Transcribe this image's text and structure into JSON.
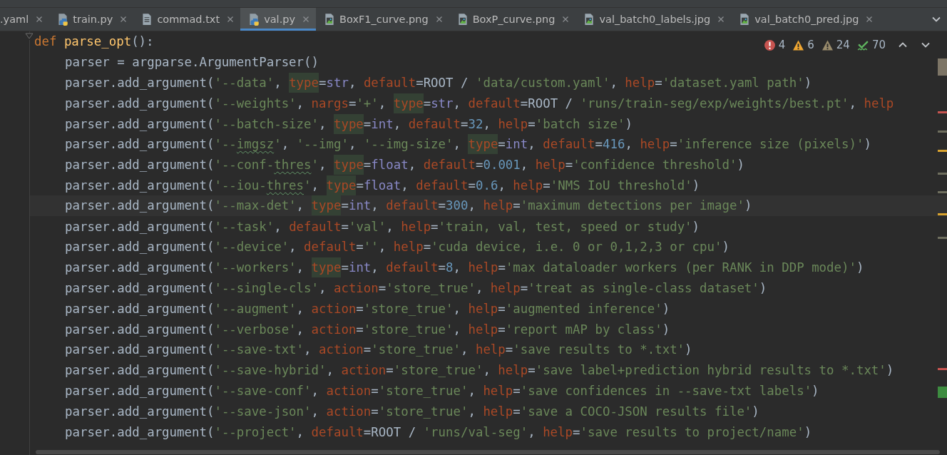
{
  "tabs": [
    {
      "label": ".yaml",
      "kind": "yaml",
      "selected": false
    },
    {
      "label": "train.py",
      "kind": "python",
      "selected": false
    },
    {
      "label": "commad.txt",
      "kind": "text",
      "selected": false
    },
    {
      "label": "val.py",
      "kind": "python",
      "selected": true
    },
    {
      "label": "BoxF1_curve.png",
      "kind": "image",
      "selected": false
    },
    {
      "label": "BoxP_curve.png",
      "kind": "image",
      "selected": false
    },
    {
      "label": "val_batch0_labels.jpg",
      "kind": "image",
      "selected": false
    },
    {
      "label": "val_batch0_pred.jpg",
      "kind": "image",
      "selected": false
    }
  ],
  "inspections": [
    {
      "kind": "error",
      "count": "4"
    },
    {
      "kind": "warning",
      "count": "6"
    },
    {
      "kind": "weak",
      "count": "24"
    },
    {
      "kind": "typo",
      "count": "70"
    }
  ],
  "code": [
    {
      "current": false,
      "tokens": [
        {
          "kind": "keyword",
          "text": "def "
        },
        {
          "kind": "function",
          "text": "parse_opt"
        },
        {
          "kind": "plain",
          "text": "():"
        }
      ],
      "children": [
        {
          "current": false,
          "tokens": [
            {
              "kind": "plain",
              "text": "parser = argparse.ArgumentParser()"
            }
          ]
        },
        {
          "current": false,
          "tokens": [
            {
              "kind": "plain",
              "text": "parser.add_argument("
            },
            {
              "kind": "string",
              "text": "'--data'"
            },
            {
              "kind": "plain",
              "text": ", "
            },
            {
              "kind": "kwarg",
              "text": "type",
              "highlight": true
            },
            {
              "kind": "plain",
              "text": "="
            },
            {
              "kind": "builtin",
              "text": "str"
            },
            {
              "kind": "plain",
              "text": ", "
            },
            {
              "kind": "kwarg",
              "text": "default"
            },
            {
              "kind": "plain",
              "text": "=ROOT / "
            },
            {
              "kind": "string",
              "text": "'data/custom.yaml'"
            },
            {
              "kind": "plain",
              "text": ", "
            },
            {
              "kind": "kwarg",
              "text": "help"
            },
            {
              "kind": "plain",
              "text": "="
            },
            {
              "kind": "string",
              "text": "'dataset.yaml path'"
            },
            {
              "kind": "plain",
              "text": ")"
            }
          ]
        },
        {
          "current": false,
          "tokens": [
            {
              "kind": "plain",
              "text": "parser.add_argument("
            },
            {
              "kind": "string",
              "text": "'--weights'"
            },
            {
              "kind": "plain",
              "text": ", "
            },
            {
              "kind": "kwarg",
              "text": "nargs"
            },
            {
              "kind": "plain",
              "text": "="
            },
            {
              "kind": "string",
              "text": "'+'"
            },
            {
              "kind": "plain",
              "text": ", "
            },
            {
              "kind": "kwarg",
              "text": "type",
              "highlight": true
            },
            {
              "kind": "plain",
              "text": "="
            },
            {
              "kind": "builtin",
              "text": "str"
            },
            {
              "kind": "plain",
              "text": ", "
            },
            {
              "kind": "kwarg",
              "text": "default"
            },
            {
              "kind": "plain",
              "text": "=ROOT / "
            },
            {
              "kind": "string",
              "text": "'runs/train-seg/exp/weights/best.pt'"
            },
            {
              "kind": "plain",
              "text": ", "
            },
            {
              "kind": "kwarg",
              "text": "help"
            }
          ]
        },
        {
          "current": false,
          "tokens": [
            {
              "kind": "plain",
              "text": "parser.add_argument("
            },
            {
              "kind": "string",
              "text": "'--batch-size'"
            },
            {
              "kind": "plain",
              "text": ", "
            },
            {
              "kind": "kwarg",
              "text": "type",
              "highlight": true
            },
            {
              "kind": "plain",
              "text": "="
            },
            {
              "kind": "builtin",
              "text": "int"
            },
            {
              "kind": "plain",
              "text": ", "
            },
            {
              "kind": "kwarg",
              "text": "default"
            },
            {
              "kind": "plain",
              "text": "="
            },
            {
              "kind": "number",
              "text": "32"
            },
            {
              "kind": "plain",
              "text": ", "
            },
            {
              "kind": "kwarg",
              "text": "help"
            },
            {
              "kind": "plain",
              "text": "="
            },
            {
              "kind": "string",
              "text": "'batch size'"
            },
            {
              "kind": "plain",
              "text": ")"
            }
          ]
        },
        {
          "current": false,
          "tokens": [
            {
              "kind": "plain",
              "text": "parser.add_argument("
            },
            {
              "kind": "string",
              "text": "'--"
            },
            {
              "kind": "string",
              "text": "imgsz",
              "typo": true
            },
            {
              "kind": "string",
              "text": "'"
            },
            {
              "kind": "plain",
              "text": ", "
            },
            {
              "kind": "string",
              "text": "'--img'"
            },
            {
              "kind": "plain",
              "text": ", "
            },
            {
              "kind": "string",
              "text": "'--img-size'"
            },
            {
              "kind": "plain",
              "text": ", "
            },
            {
              "kind": "kwarg",
              "text": "type",
              "highlight": true
            },
            {
              "kind": "plain",
              "text": "="
            },
            {
              "kind": "builtin",
              "text": "int"
            },
            {
              "kind": "plain",
              "text": ", "
            },
            {
              "kind": "kwarg",
              "text": "default"
            },
            {
              "kind": "plain",
              "text": "="
            },
            {
              "kind": "number",
              "text": "416"
            },
            {
              "kind": "plain",
              "text": ", "
            },
            {
              "kind": "kwarg",
              "text": "help"
            },
            {
              "kind": "plain",
              "text": "="
            },
            {
              "kind": "string",
              "text": "'inference size (pixels)'"
            },
            {
              "kind": "plain",
              "text": ")"
            }
          ]
        },
        {
          "current": false,
          "tokens": [
            {
              "kind": "plain",
              "text": "parser.add_argument("
            },
            {
              "kind": "string",
              "text": "'--conf-"
            },
            {
              "kind": "string",
              "text": "thres",
              "typo": true
            },
            {
              "kind": "string",
              "text": "'"
            },
            {
              "kind": "plain",
              "text": ", "
            },
            {
              "kind": "kwarg",
              "text": "type",
              "highlight": true
            },
            {
              "kind": "plain",
              "text": "="
            },
            {
              "kind": "builtin",
              "text": "float"
            },
            {
              "kind": "plain",
              "text": ", "
            },
            {
              "kind": "kwarg",
              "text": "default"
            },
            {
              "kind": "plain",
              "text": "="
            },
            {
              "kind": "number",
              "text": "0.001"
            },
            {
              "kind": "plain",
              "text": ", "
            },
            {
              "kind": "kwarg",
              "text": "help"
            },
            {
              "kind": "plain",
              "text": "="
            },
            {
              "kind": "string",
              "text": "'confidence threshold'"
            },
            {
              "kind": "plain",
              "text": ")"
            }
          ]
        },
        {
          "current": false,
          "tokens": [
            {
              "kind": "plain",
              "text": "parser.add_argument("
            },
            {
              "kind": "string",
              "text": "'--iou-"
            },
            {
              "kind": "string",
              "text": "thres",
              "typo": true
            },
            {
              "kind": "string",
              "text": "'"
            },
            {
              "kind": "plain",
              "text": ", "
            },
            {
              "kind": "kwarg",
              "text": "type",
              "highlight": true
            },
            {
              "kind": "plain",
              "text": "="
            },
            {
              "kind": "builtin",
              "text": "float"
            },
            {
              "kind": "plain",
              "text": ", "
            },
            {
              "kind": "kwarg",
              "text": "default"
            },
            {
              "kind": "plain",
              "text": "="
            },
            {
              "kind": "number",
              "text": "0.6"
            },
            {
              "kind": "plain",
              "text": ", "
            },
            {
              "kind": "kwarg",
              "text": "help"
            },
            {
              "kind": "plain",
              "text": "="
            },
            {
              "kind": "string",
              "text": "'NMS IoU threshold'"
            },
            {
              "kind": "plain",
              "text": ")"
            }
          ]
        },
        {
          "current": true,
          "tokens": [
            {
              "kind": "plain",
              "text": "parser.add_argument("
            },
            {
              "kind": "string",
              "text": "'--max-det'"
            },
            {
              "kind": "plain",
              "text": ", "
            },
            {
              "kind": "kwarg",
              "text": "t",
              "highlight": true
            },
            {
              "kind": "kwarg",
              "text": "ype",
              "highlight": true,
              "caret": true
            },
            {
              "kind": "plain",
              "text": "="
            },
            {
              "kind": "builtin",
              "text": "int"
            },
            {
              "kind": "plain",
              "text": ", "
            },
            {
              "kind": "kwarg",
              "text": "default"
            },
            {
              "kind": "plain",
              "text": "="
            },
            {
              "kind": "number",
              "text": "300"
            },
            {
              "kind": "plain",
              "text": ", "
            },
            {
              "kind": "kwarg",
              "text": "help"
            },
            {
              "kind": "plain",
              "text": "="
            },
            {
              "kind": "string",
              "text": "'maximum detections per image'"
            },
            {
              "kind": "plain",
              "text": ")"
            }
          ]
        },
        {
          "current": false,
          "tokens": [
            {
              "kind": "plain",
              "text": "parser.add_argument("
            },
            {
              "kind": "string",
              "text": "'--task'"
            },
            {
              "kind": "plain",
              "text": ", "
            },
            {
              "kind": "kwarg",
              "text": "default"
            },
            {
              "kind": "plain",
              "text": "="
            },
            {
              "kind": "string",
              "text": "'val'"
            },
            {
              "kind": "plain",
              "text": ", "
            },
            {
              "kind": "kwarg",
              "text": "help"
            },
            {
              "kind": "plain",
              "text": "="
            },
            {
              "kind": "string",
              "text": "'train, val, test, speed or study'"
            },
            {
              "kind": "plain",
              "text": ")"
            }
          ]
        },
        {
          "current": false,
          "tokens": [
            {
              "kind": "plain",
              "text": "parser.add_argument("
            },
            {
              "kind": "string",
              "text": "'--device'"
            },
            {
              "kind": "plain",
              "text": ", "
            },
            {
              "kind": "kwarg",
              "text": "default"
            },
            {
              "kind": "plain",
              "text": "="
            },
            {
              "kind": "string",
              "text": "''"
            },
            {
              "kind": "plain",
              "text": ", "
            },
            {
              "kind": "kwarg",
              "text": "help"
            },
            {
              "kind": "plain",
              "text": "="
            },
            {
              "kind": "string",
              "text": "'cuda device, i.e. 0 or 0,1,2,3 or cpu'"
            },
            {
              "kind": "plain",
              "text": ")"
            }
          ]
        },
        {
          "current": false,
          "tokens": [
            {
              "kind": "plain",
              "text": "parser.add_argument("
            },
            {
              "kind": "string",
              "text": "'--workers'"
            },
            {
              "kind": "plain",
              "text": ", "
            },
            {
              "kind": "kwarg",
              "text": "type",
              "highlight": true
            },
            {
              "kind": "plain",
              "text": "="
            },
            {
              "kind": "builtin",
              "text": "int"
            },
            {
              "kind": "plain",
              "text": ", "
            },
            {
              "kind": "kwarg",
              "text": "default"
            },
            {
              "kind": "plain",
              "text": "="
            },
            {
              "kind": "number",
              "text": "8"
            },
            {
              "kind": "plain",
              "text": ", "
            },
            {
              "kind": "kwarg",
              "text": "help"
            },
            {
              "kind": "plain",
              "text": "="
            },
            {
              "kind": "string",
              "text": "'max dataloader workers (per RANK in DDP mode)'"
            },
            {
              "kind": "plain",
              "text": ")"
            }
          ]
        },
        {
          "current": false,
          "tokens": [
            {
              "kind": "plain",
              "text": "parser.add_argument("
            },
            {
              "kind": "string",
              "text": "'--single-cls'"
            },
            {
              "kind": "plain",
              "text": ", "
            },
            {
              "kind": "kwarg",
              "text": "action"
            },
            {
              "kind": "plain",
              "text": "="
            },
            {
              "kind": "string",
              "text": "'store_true'"
            },
            {
              "kind": "plain",
              "text": ", "
            },
            {
              "kind": "kwarg",
              "text": "help"
            },
            {
              "kind": "plain",
              "text": "="
            },
            {
              "kind": "string",
              "text": "'treat as single-class dataset'"
            },
            {
              "kind": "plain",
              "text": ")"
            }
          ]
        },
        {
          "current": false,
          "tokens": [
            {
              "kind": "plain",
              "text": "parser.add_argument("
            },
            {
              "kind": "string",
              "text": "'--augment'"
            },
            {
              "kind": "plain",
              "text": ", "
            },
            {
              "kind": "kwarg",
              "text": "action"
            },
            {
              "kind": "plain",
              "text": "="
            },
            {
              "kind": "string",
              "text": "'store_true'"
            },
            {
              "kind": "plain",
              "text": ", "
            },
            {
              "kind": "kwarg",
              "text": "help"
            },
            {
              "kind": "plain",
              "text": "="
            },
            {
              "kind": "string",
              "text": "'augmented inference'"
            },
            {
              "kind": "plain",
              "text": ")"
            }
          ]
        },
        {
          "current": false,
          "tokens": [
            {
              "kind": "plain",
              "text": "parser.add_argument("
            },
            {
              "kind": "string",
              "text": "'--verbose'"
            },
            {
              "kind": "plain",
              "text": ", "
            },
            {
              "kind": "kwarg",
              "text": "action"
            },
            {
              "kind": "plain",
              "text": "="
            },
            {
              "kind": "string",
              "text": "'store_true'"
            },
            {
              "kind": "plain",
              "text": ", "
            },
            {
              "kind": "kwarg",
              "text": "help"
            },
            {
              "kind": "plain",
              "text": "="
            },
            {
              "kind": "string",
              "text": "'report mAP by class'"
            },
            {
              "kind": "plain",
              "text": ")"
            }
          ]
        },
        {
          "current": false,
          "tokens": [
            {
              "kind": "plain",
              "text": "parser.add_argument("
            },
            {
              "kind": "string",
              "text": "'--save-txt'"
            },
            {
              "kind": "plain",
              "text": ", "
            },
            {
              "kind": "kwarg",
              "text": "action"
            },
            {
              "kind": "plain",
              "text": "="
            },
            {
              "kind": "string",
              "text": "'store_true'"
            },
            {
              "kind": "plain",
              "text": ", "
            },
            {
              "kind": "kwarg",
              "text": "help"
            },
            {
              "kind": "plain",
              "text": "="
            },
            {
              "kind": "string",
              "text": "'save results to *.txt'"
            },
            {
              "kind": "plain",
              "text": ")"
            }
          ]
        },
        {
          "current": false,
          "tokens": [
            {
              "kind": "plain",
              "text": "parser.add_argument("
            },
            {
              "kind": "string",
              "text": "'--save-hybrid'"
            },
            {
              "kind": "plain",
              "text": ", "
            },
            {
              "kind": "kwarg",
              "text": "action"
            },
            {
              "kind": "plain",
              "text": "="
            },
            {
              "kind": "string",
              "text": "'store_true'"
            },
            {
              "kind": "plain",
              "text": ", "
            },
            {
              "kind": "kwarg",
              "text": "help"
            },
            {
              "kind": "plain",
              "text": "="
            },
            {
              "kind": "string",
              "text": "'save label+prediction hybrid results to *.txt'"
            },
            {
              "kind": "plain",
              "text": ")"
            }
          ]
        },
        {
          "current": false,
          "tokens": [
            {
              "kind": "plain",
              "text": "parser.add_argument("
            },
            {
              "kind": "string",
              "text": "'--save-conf'"
            },
            {
              "kind": "plain",
              "text": ", "
            },
            {
              "kind": "kwarg",
              "text": "action"
            },
            {
              "kind": "plain",
              "text": "="
            },
            {
              "kind": "string",
              "text": "'store_true'"
            },
            {
              "kind": "plain",
              "text": ", "
            },
            {
              "kind": "kwarg",
              "text": "help"
            },
            {
              "kind": "plain",
              "text": "="
            },
            {
              "kind": "string",
              "text": "'save confidences in --save-txt labels'"
            },
            {
              "kind": "plain",
              "text": ")"
            }
          ]
        },
        {
          "current": false,
          "tokens": [
            {
              "kind": "plain",
              "text": "parser.add_argument("
            },
            {
              "kind": "string",
              "text": "'--save-json'"
            },
            {
              "kind": "plain",
              "text": ", "
            },
            {
              "kind": "kwarg",
              "text": "action"
            },
            {
              "kind": "plain",
              "text": "="
            },
            {
              "kind": "string",
              "text": "'store_true'"
            },
            {
              "kind": "plain",
              "text": ", "
            },
            {
              "kind": "kwarg",
              "text": "help"
            },
            {
              "kind": "plain",
              "text": "="
            },
            {
              "kind": "string",
              "text": "'save a COCO-JSON results file'"
            },
            {
              "kind": "plain",
              "text": ")"
            }
          ]
        },
        {
          "current": false,
          "tokens": [
            {
              "kind": "plain",
              "text": "parser.add_argument("
            },
            {
              "kind": "string",
              "text": "'--project'"
            },
            {
              "kind": "plain",
              "text": ", "
            },
            {
              "kind": "kwarg",
              "text": "default"
            },
            {
              "kind": "plain",
              "text": "=ROOT / "
            },
            {
              "kind": "string",
              "text": "'runs/val-seg'"
            },
            {
              "kind": "plain",
              "text": ", "
            },
            {
              "kind": "kwarg",
              "text": "help"
            },
            {
              "kind": "plain",
              "text": "="
            },
            {
              "kind": "string",
              "text": "'save results to project/name'"
            },
            {
              "kind": "plain",
              "text": ")"
            }
          ]
        }
      ]
    }
  ]
}
